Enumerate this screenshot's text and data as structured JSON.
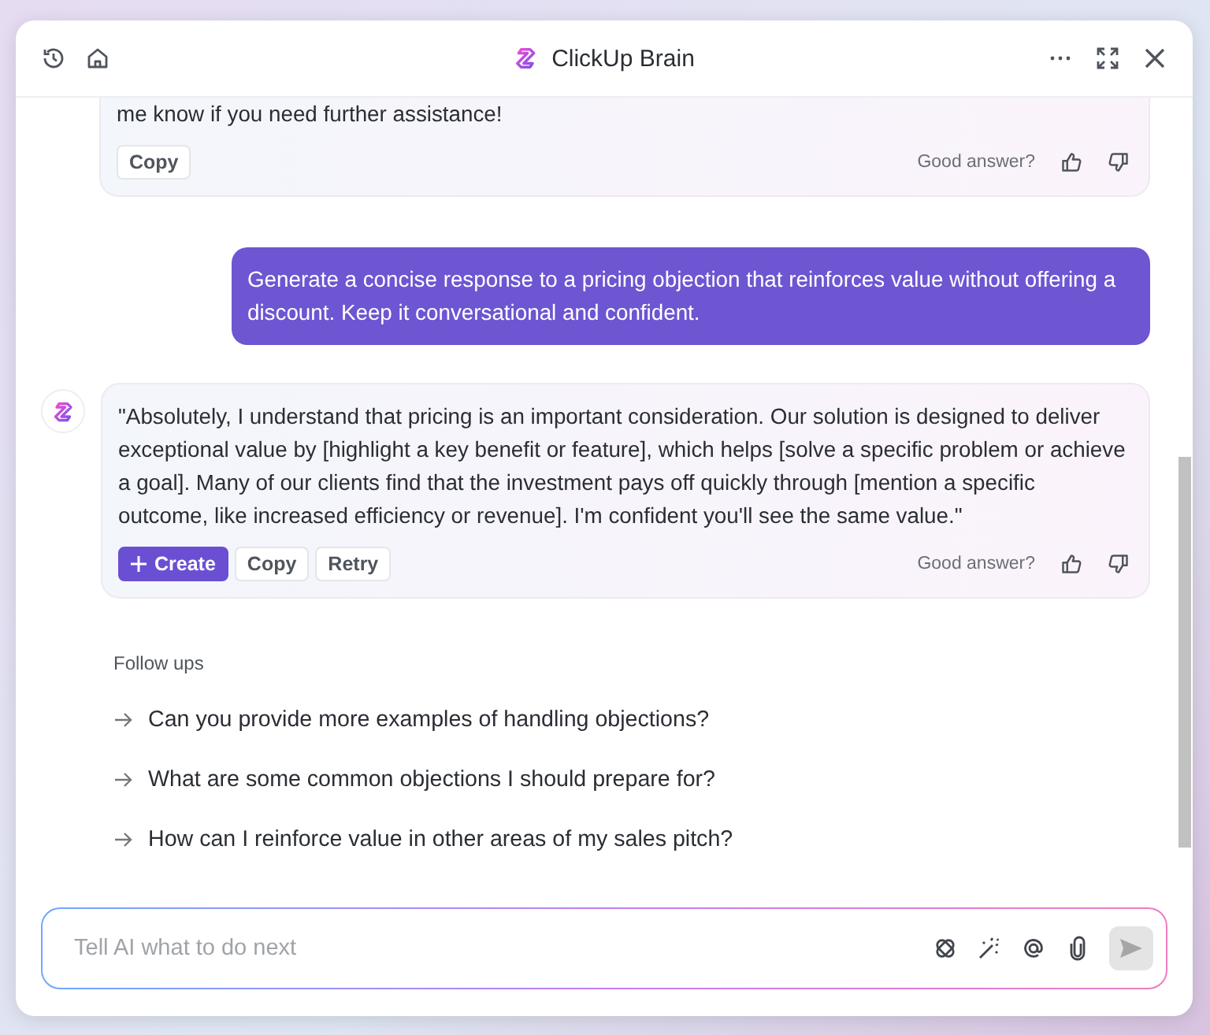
{
  "window": {
    "title": "ClickUp Brain"
  },
  "messages": [
    {
      "kind": "ai",
      "text": "me know if you need further assistance!",
      "actions": [
        {
          "label": "Copy",
          "kind": "plain"
        }
      ],
      "feedback": "Good answer?",
      "cut": true
    },
    {
      "kind": "user",
      "text": "Generate a concise response to a pricing objection that reinforces value without offering a discount. Keep it conversational and confident."
    },
    {
      "kind": "ai",
      "text": "\"Absolutely, I understand that pricing is an important consideration. Our solution is designed to deliver exceptional value by [highlight a key benefit or feature], which helps [solve a specific problem or achieve a goal]. Many of our clients find that the investment pays off quickly through [mention a specific outcome, like increased efficiency or revenue]. I'm confident you'll see the same value.\"",
      "actions": [
        {
          "label": "Create",
          "kind": "primary"
        },
        {
          "label": "Copy",
          "kind": "plain"
        },
        {
          "label": "Retry",
          "kind": "plain"
        }
      ],
      "feedback": "Good answer?",
      "cut": false
    }
  ],
  "follow_ups": {
    "title": "Follow ups",
    "items": [
      "Can you provide more examples of handling objections?",
      "What are some common objections I should prepare for?",
      "How can I reinforce value in other areas of my sales pitch?"
    ]
  },
  "composer": {
    "placeholder": "Tell AI what to do next"
  }
}
